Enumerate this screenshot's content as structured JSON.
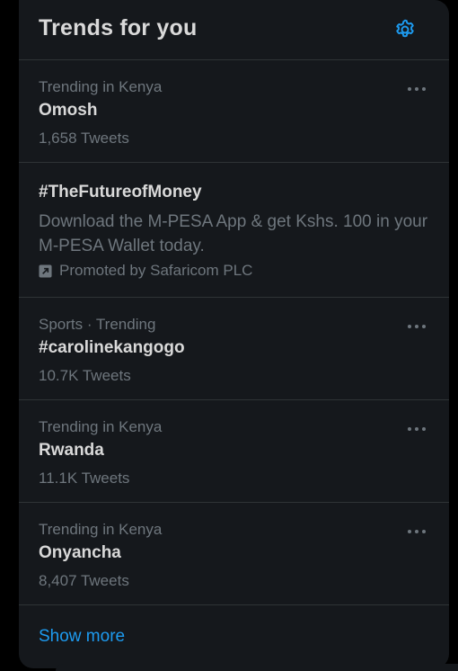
{
  "header": {
    "title": "Trends for you",
    "settings_icon": "gear-icon"
  },
  "trends": [
    {
      "context": "Trending in Kenya",
      "name": "Omosh",
      "count": "1,658 Tweets"
    },
    {
      "context": "Sports · Trending",
      "name": "#carolinekangogo",
      "count": "10.7K Tweets"
    },
    {
      "context": "Trending in Kenya",
      "name": "Rwanda",
      "count": "11.1K Tweets"
    },
    {
      "context": "Trending in Kenya",
      "name": "Onyancha",
      "count": "8,407 Tweets"
    }
  ],
  "promoted": {
    "name": "#TheFutureofMoney",
    "description": "Download the M-PESA App & get Kshs. 100 in your M-PESA Wallet today.",
    "by": "Promoted by Safaricom PLC",
    "icon": "promoted-arrow-icon"
  },
  "footer": {
    "show_more": "Show more"
  },
  "colors": {
    "background": "#15181c",
    "text_primary": "#d9d9d9",
    "text_secondary": "#6e767d",
    "accent": "#1d9bf0",
    "divider": "#2f3336"
  }
}
